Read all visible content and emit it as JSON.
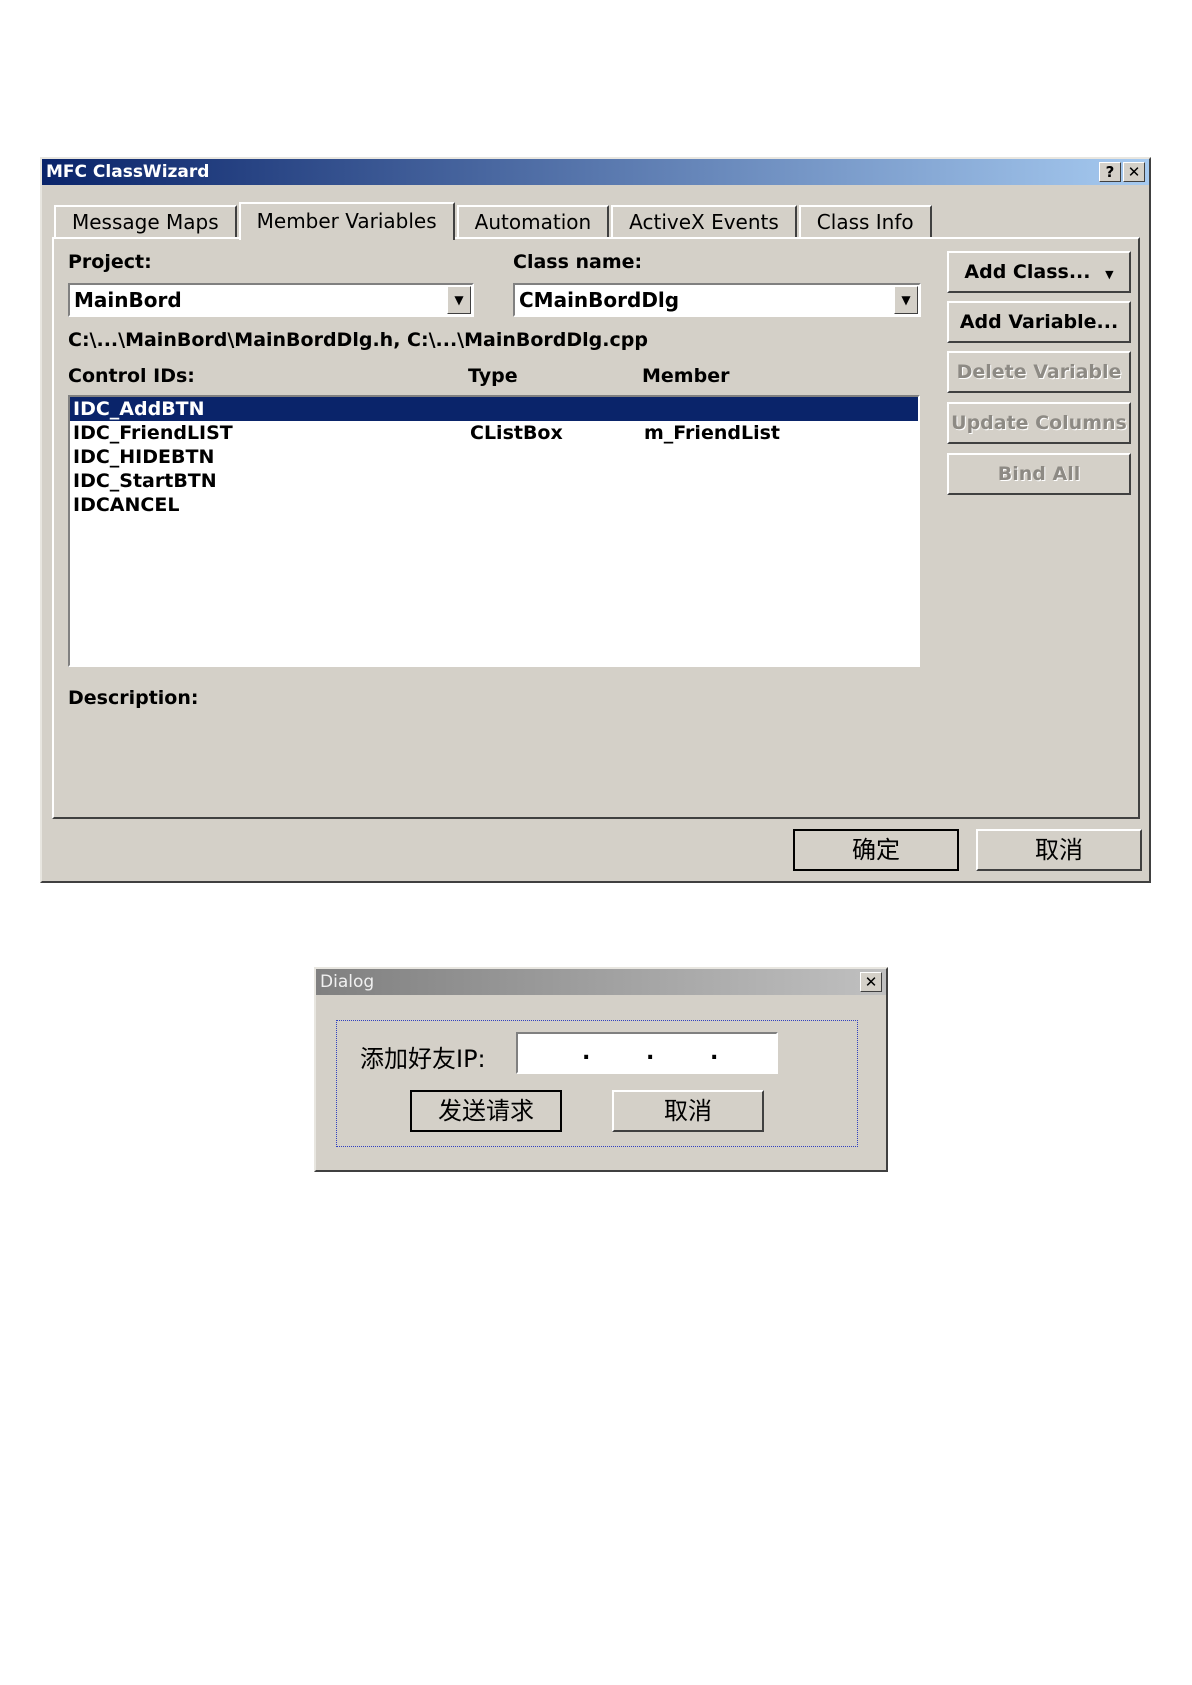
{
  "classwizard": {
    "title": "MFC ClassWizard",
    "help_label": "?",
    "close_label": "✕",
    "tabs": [
      "Message Maps",
      "Member Variables",
      "Automation",
      "ActiveX Events",
      "Class Info"
    ],
    "project_label": "Project:",
    "project_value": "MainBord",
    "classname_label": "Class name:",
    "classname_value": "CMainBordDlg",
    "file_path": "C:\\...\\MainBord\\MainBordDlg.h, C:\\...\\MainBordDlg.cpp",
    "columns": {
      "control_ids": "Control IDs:",
      "type": "Type",
      "member": "Member"
    },
    "rows": [
      {
        "id": "IDC_AddBTN",
        "type": "",
        "member": ""
      },
      {
        "id": "IDC_FriendLIST",
        "type": "CListBox",
        "member": "m_FriendList"
      },
      {
        "id": "IDC_HIDEBTN",
        "type": "",
        "member": ""
      },
      {
        "id": "IDC_StartBTN",
        "type": "",
        "member": ""
      },
      {
        "id": "IDCANCEL",
        "type": "",
        "member": ""
      }
    ],
    "buttons": {
      "add_class": "Add Class...",
      "add_variable": "Add Variable...",
      "delete_variable": "Delete Variable",
      "update_columns": "Update Columns",
      "bind_all": "Bind All"
    },
    "description_label": "Description:",
    "ok_label": "确定",
    "cancel_label": "取消",
    "dropdown_glyph": "▼"
  },
  "dialog": {
    "title": "Dialog",
    "close_label": "✕",
    "ip_label": "添加好友IP:",
    "ip_dots": [
      ".",
      ".",
      "."
    ],
    "send_label": "发送请求",
    "cancel_label": "取消"
  },
  "colors": {
    "face": "#d4d0c8",
    "active_title": "#0a246a",
    "inactive_title": "#808080",
    "selection": "#0a246a"
  }
}
